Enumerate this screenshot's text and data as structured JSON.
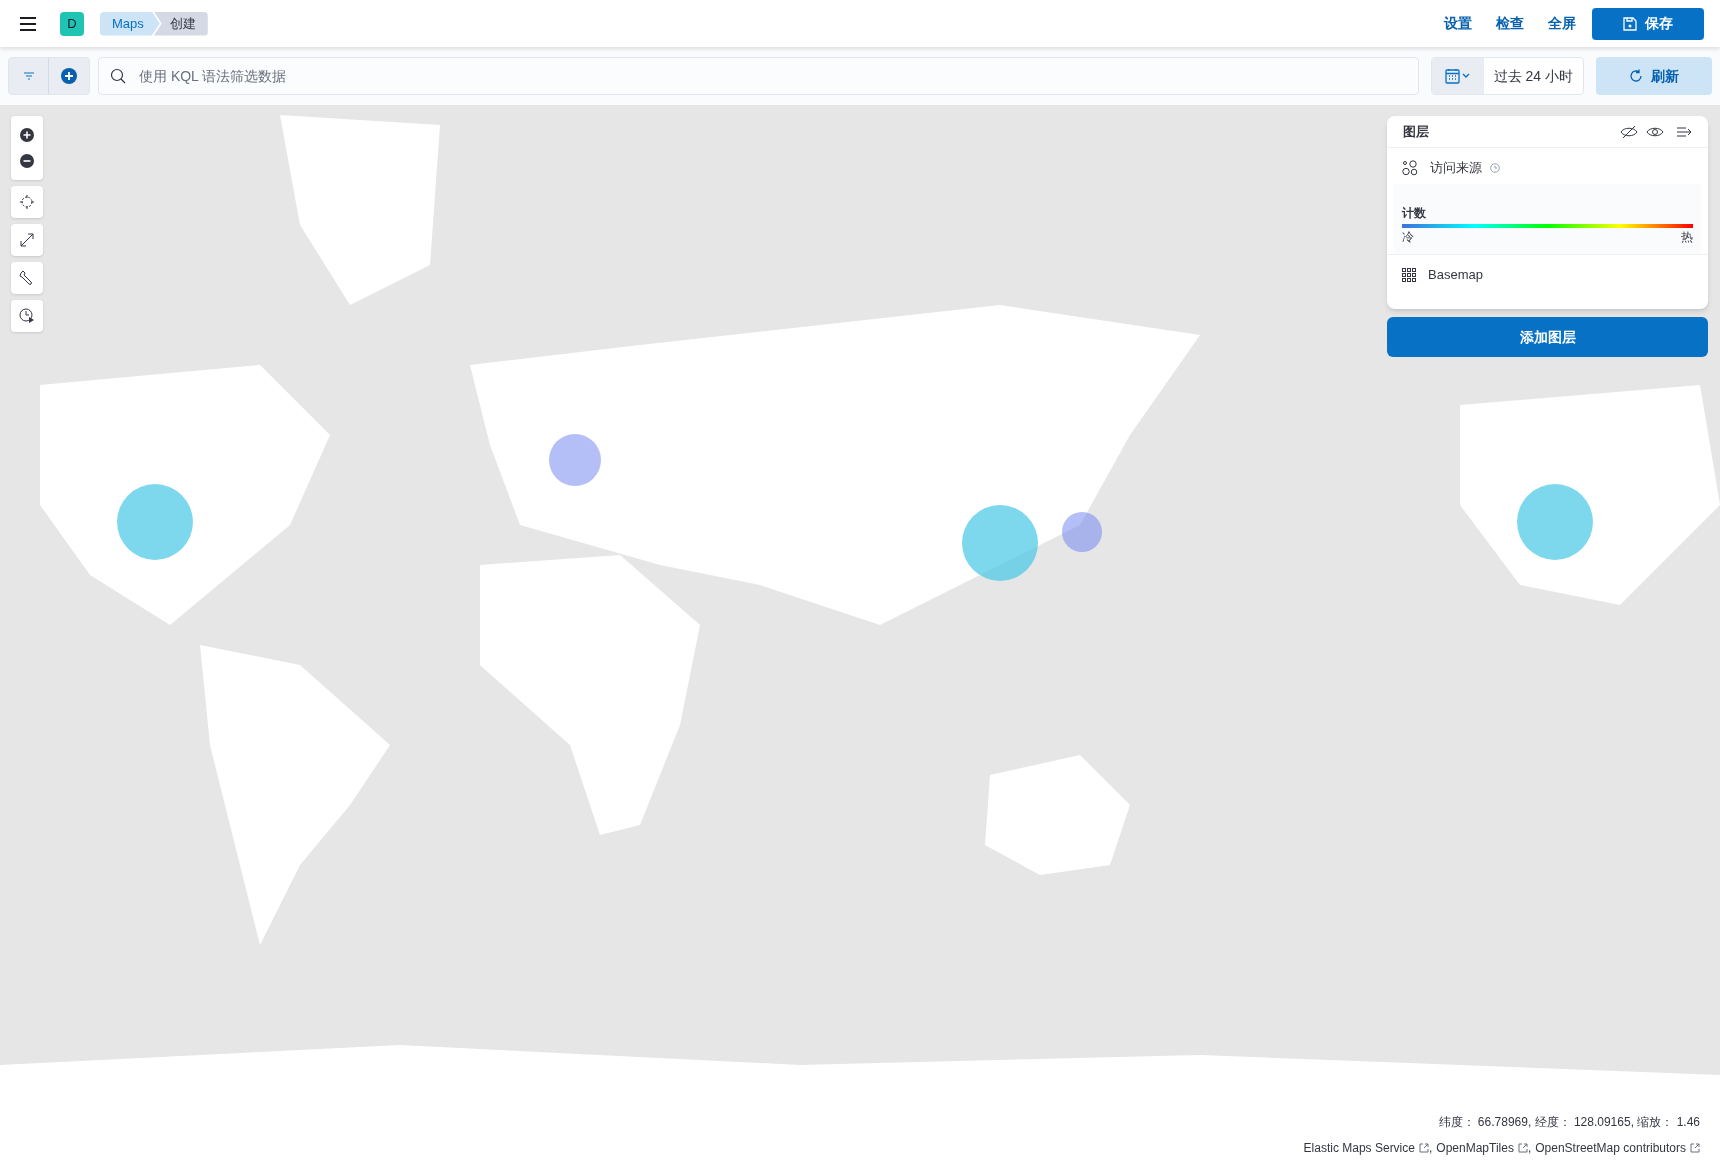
{
  "header": {
    "avatar": "D",
    "breadcrumbs": [
      {
        "label": "Maps",
        "current": false
      },
      {
        "label": "创建",
        "current": true
      }
    ],
    "actions": [
      "设置",
      "检查",
      "全屏"
    ],
    "save_button": "保存"
  },
  "query_bar": {
    "placeholder": "使用 KQL 语法筛选数据",
    "time_range": "过去 24 小时",
    "refresh_button": "刷新"
  },
  "layers_panel": {
    "title": "图层",
    "layers": [
      {
        "kind": "heatmap",
        "name": "访问来源",
        "legend": {
          "title": "计数",
          "low": "冷",
          "high": "热"
        }
      },
      {
        "kind": "tiles",
        "name": "Basemap"
      }
    ],
    "add_button": "添加图层"
  },
  "status": {
    "coordinates": "纬度： 66.78969, 经度： 128.09165, 缩放： 1.46",
    "attributions": [
      "Elastic Maps Service",
      "OpenMapTiles",
      "OpenStreetMap contributors"
    ],
    "separator": ","
  }
}
